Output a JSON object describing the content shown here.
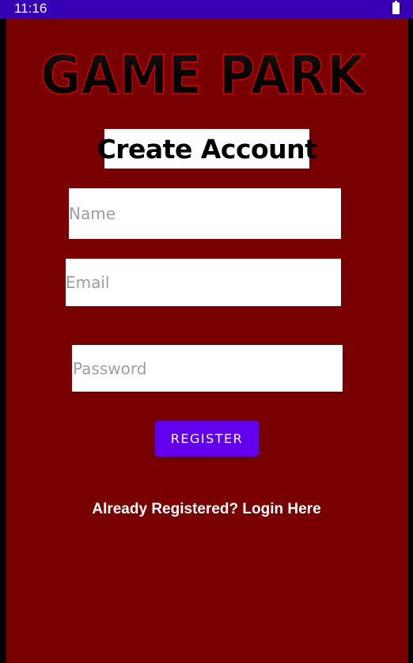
{
  "status_bar": {
    "time": "11:16",
    "battery_icon": "battery-full-icon"
  },
  "logo": {
    "text": "GAME PARK",
    "colors": {
      "dark": "#000000",
      "accent": "#cc0000"
    }
  },
  "title": "Create Account",
  "form": {
    "name_placeholder": "Name",
    "name_value": "",
    "email_placeholder": "Email",
    "email_value": "",
    "password_placeholder": "Password",
    "password_value": "",
    "register_label": "REGISTER"
  },
  "login_link": "Already Registered? Login Here",
  "colors": {
    "status_bar": "#3700b3",
    "background": "#780000",
    "button": "#6200ee",
    "field": "#ffffff"
  }
}
